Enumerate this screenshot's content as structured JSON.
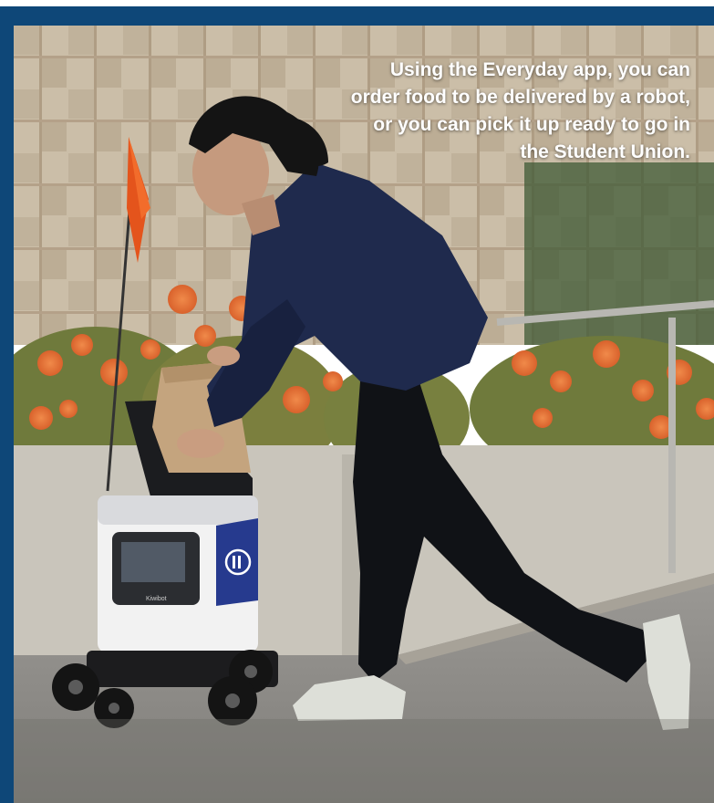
{
  "caption": "Using the Everyday app, you can order food to be delivered by a robot, or you can pick it up ready to go in the Student Union.",
  "colors": {
    "frame": "#0e4778",
    "caption_text": "#ffffff"
  },
  "robot": {
    "brand_label": "Kiwibot"
  }
}
